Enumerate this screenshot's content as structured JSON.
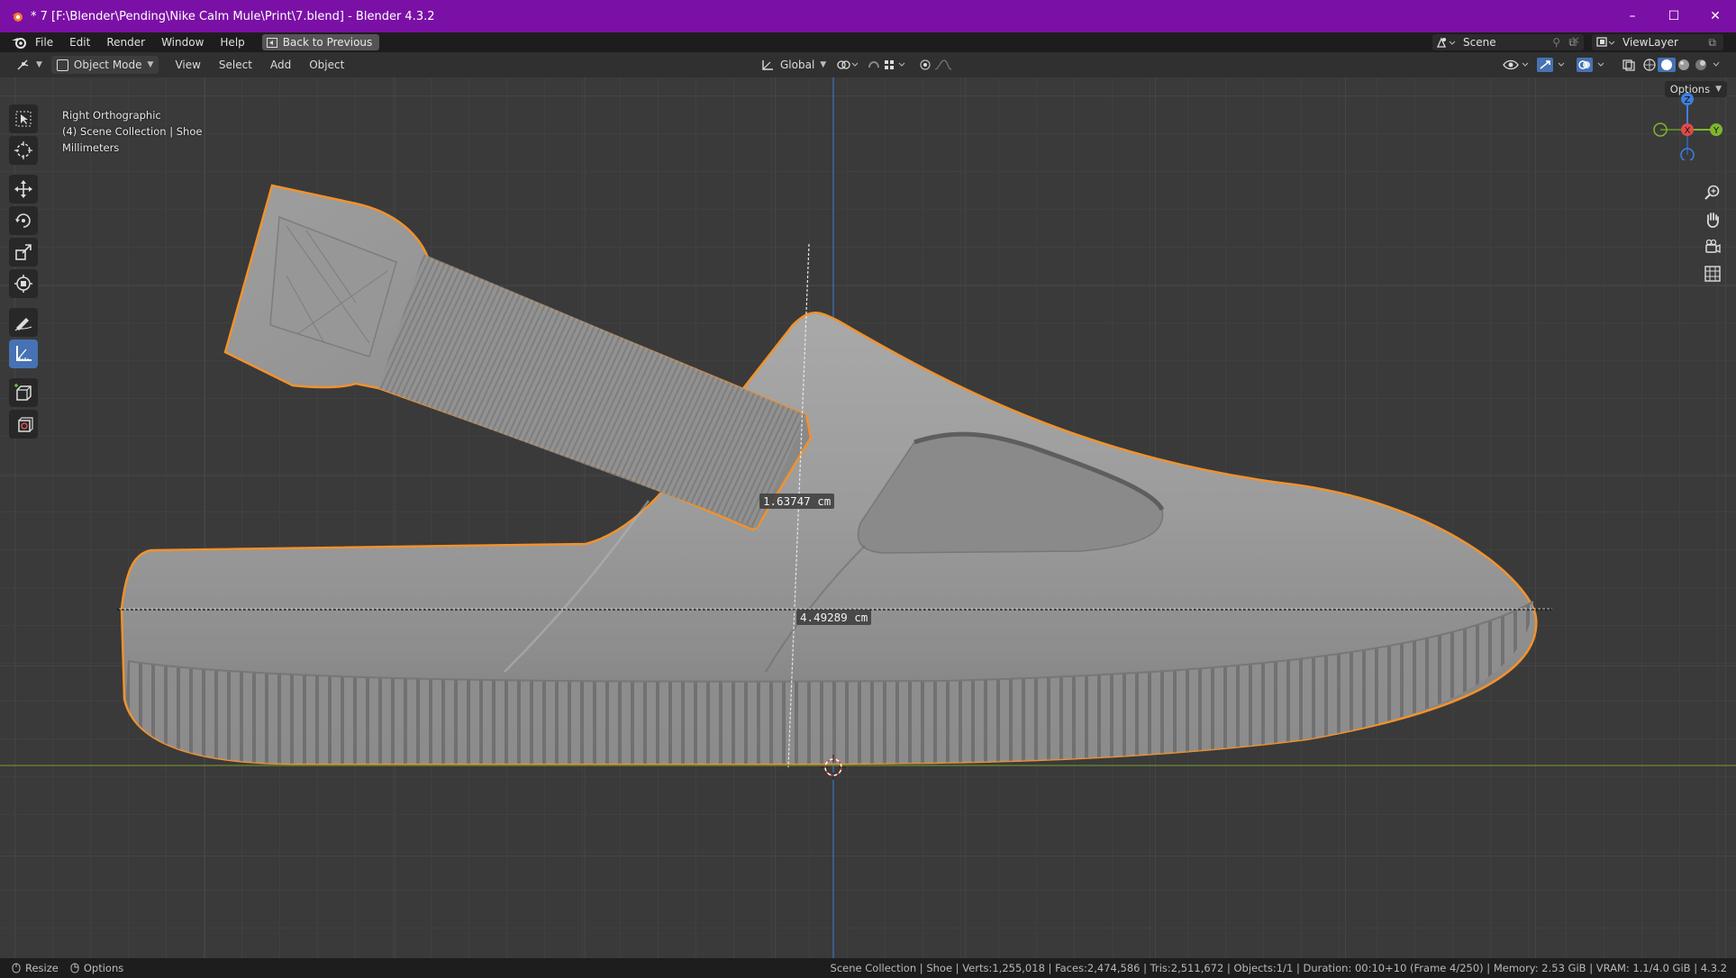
{
  "window": {
    "title": "* 7 [F:\\Blender\\Pending\\Nike Calm Mule\\Print\\7.blend] - Blender 4.3.2",
    "minimize_glyph": "–",
    "maximize_glyph": "☐",
    "close_glyph": "✕",
    "accent_color": "#7b10a6"
  },
  "menubar": {
    "items": [
      "File",
      "Edit",
      "Render",
      "Window",
      "Help"
    ],
    "back_button": "Back to Previous",
    "scene_name": "Scene",
    "view_layer": "ViewLayer"
  },
  "header": {
    "mode": "Object Mode",
    "menus": [
      "View",
      "Select",
      "Add",
      "Object"
    ],
    "transform_orientation": "Global"
  },
  "viewport": {
    "view_name": "Right Orthographic",
    "collection": "(4) Scene Collection | Shoe",
    "units": "Millimeters",
    "options_label": "Options",
    "measurements": [
      "1.63747 cm",
      "4.49289 cm"
    ],
    "gizmo_axes": {
      "z": "Z",
      "x": "X",
      "y": "Y"
    },
    "selection_color": "#f0922e"
  },
  "toolbar": {
    "tools": [
      "select-box",
      "cursor",
      "move",
      "rotate",
      "scale",
      "transform",
      "annotate",
      "measure",
      "add-cube",
      "add-primitive"
    ],
    "active_tool": "measure"
  },
  "statusbar": {
    "resize_label": "Resize",
    "options_label": "Options",
    "stats": "Scene Collection | Shoe | Verts:1,255,018 | Faces:2,474,586 | Tris:2,511,672 | Objects:1/1 | Duration: 00:10+10 (Frame 4/250) | Memory: 2.53 GiB | VRAM: 1.1/4.0 GiB | 4.3.2"
  }
}
